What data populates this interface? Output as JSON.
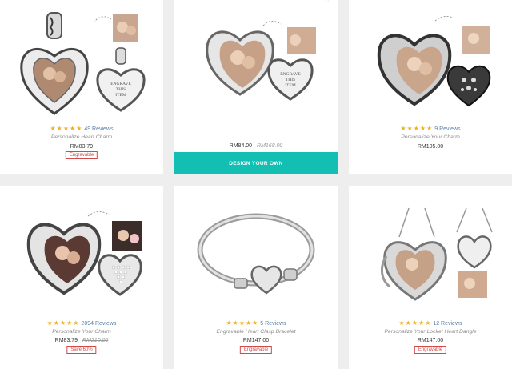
{
  "products": [
    {
      "reviews": "49 Reviews",
      "name": "Personalize Heart Charm",
      "price": "RM83.79",
      "old_price": "",
      "badge": "Engravable",
      "stars": "★★★★★"
    },
    {
      "reviews": "",
      "name": "",
      "price": "RM84.00",
      "old_price": "RM168.00",
      "badge": "",
      "stars": "",
      "button": "DESIGN YOUR OWN"
    },
    {
      "reviews": "9 Reviews",
      "name": "Personalize Your Charm",
      "price": "RM105.00",
      "old_price": "",
      "badge": "",
      "stars": "★★★★★"
    },
    {
      "reviews": "2094 Reviews",
      "name": "Personalize Your Charm",
      "price": "RM83.79",
      "old_price": "RM210.00",
      "badge": "Save 60%",
      "stars": "★★★★★"
    },
    {
      "reviews": "5 Reviews",
      "name": "Engravable Heart Clasp Bracelet",
      "price": "RM147.00",
      "old_price": "",
      "badge": "Engravable",
      "stars": "★★★★★"
    },
    {
      "reviews": "12 Reviews",
      "name": "Personalize Your Locket Heart Dangle",
      "price": "RM147.00",
      "old_price": "",
      "badge": "Engravable",
      "stars": "★★★★★"
    }
  ],
  "engraving_text": [
    "ENGRAVE",
    "THIS",
    "ITEM"
  ],
  "colors": {
    "accent": "#13bfb3",
    "star": "#f2b01e",
    "badge": "#d04a4a"
  }
}
